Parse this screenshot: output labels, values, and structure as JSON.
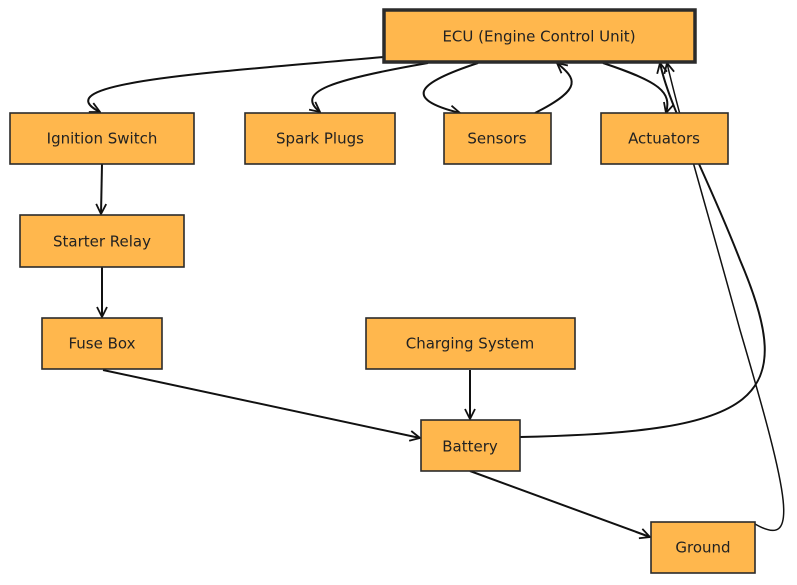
{
  "nodes": {
    "ecu": "ECU (Engine Control Unit)",
    "ignition": "Ignition Switch",
    "spark": "Spark Plugs",
    "sensors": "Sensors",
    "actuators": "Actuators",
    "starter": "Starter Relay",
    "fuse": "Fuse Box",
    "charging": "Charging System",
    "battery": "Battery",
    "ground": "Ground"
  },
  "edges": [
    {
      "from": "ECU (Engine Control Unit)",
      "to": "Ignition Switch"
    },
    {
      "from": "ECU (Engine Control Unit)",
      "to": "Spark Plugs"
    },
    {
      "from": "ECU (Engine Control Unit)",
      "to": "Sensors"
    },
    {
      "from": "Sensors",
      "to": "ECU (Engine Control Unit)"
    },
    {
      "from": "ECU (Engine Control Unit)",
      "to": "Actuators"
    },
    {
      "from": "Ignition Switch",
      "to": "Starter Relay"
    },
    {
      "from": "Starter Relay",
      "to": "Fuse Box"
    },
    {
      "from": "Fuse Box",
      "to": "Battery"
    },
    {
      "from": "Charging System",
      "to": "Battery"
    },
    {
      "from": "Battery",
      "to": "ECU (Engine Control Unit)"
    },
    {
      "from": "Battery",
      "to": "Ground"
    },
    {
      "from": "Ground",
      "to": "ECU (Engine Control Unit)"
    }
  ],
  "colors": {
    "node_fill": "#ffb74d",
    "stroke": "#2b2b2b"
  }
}
